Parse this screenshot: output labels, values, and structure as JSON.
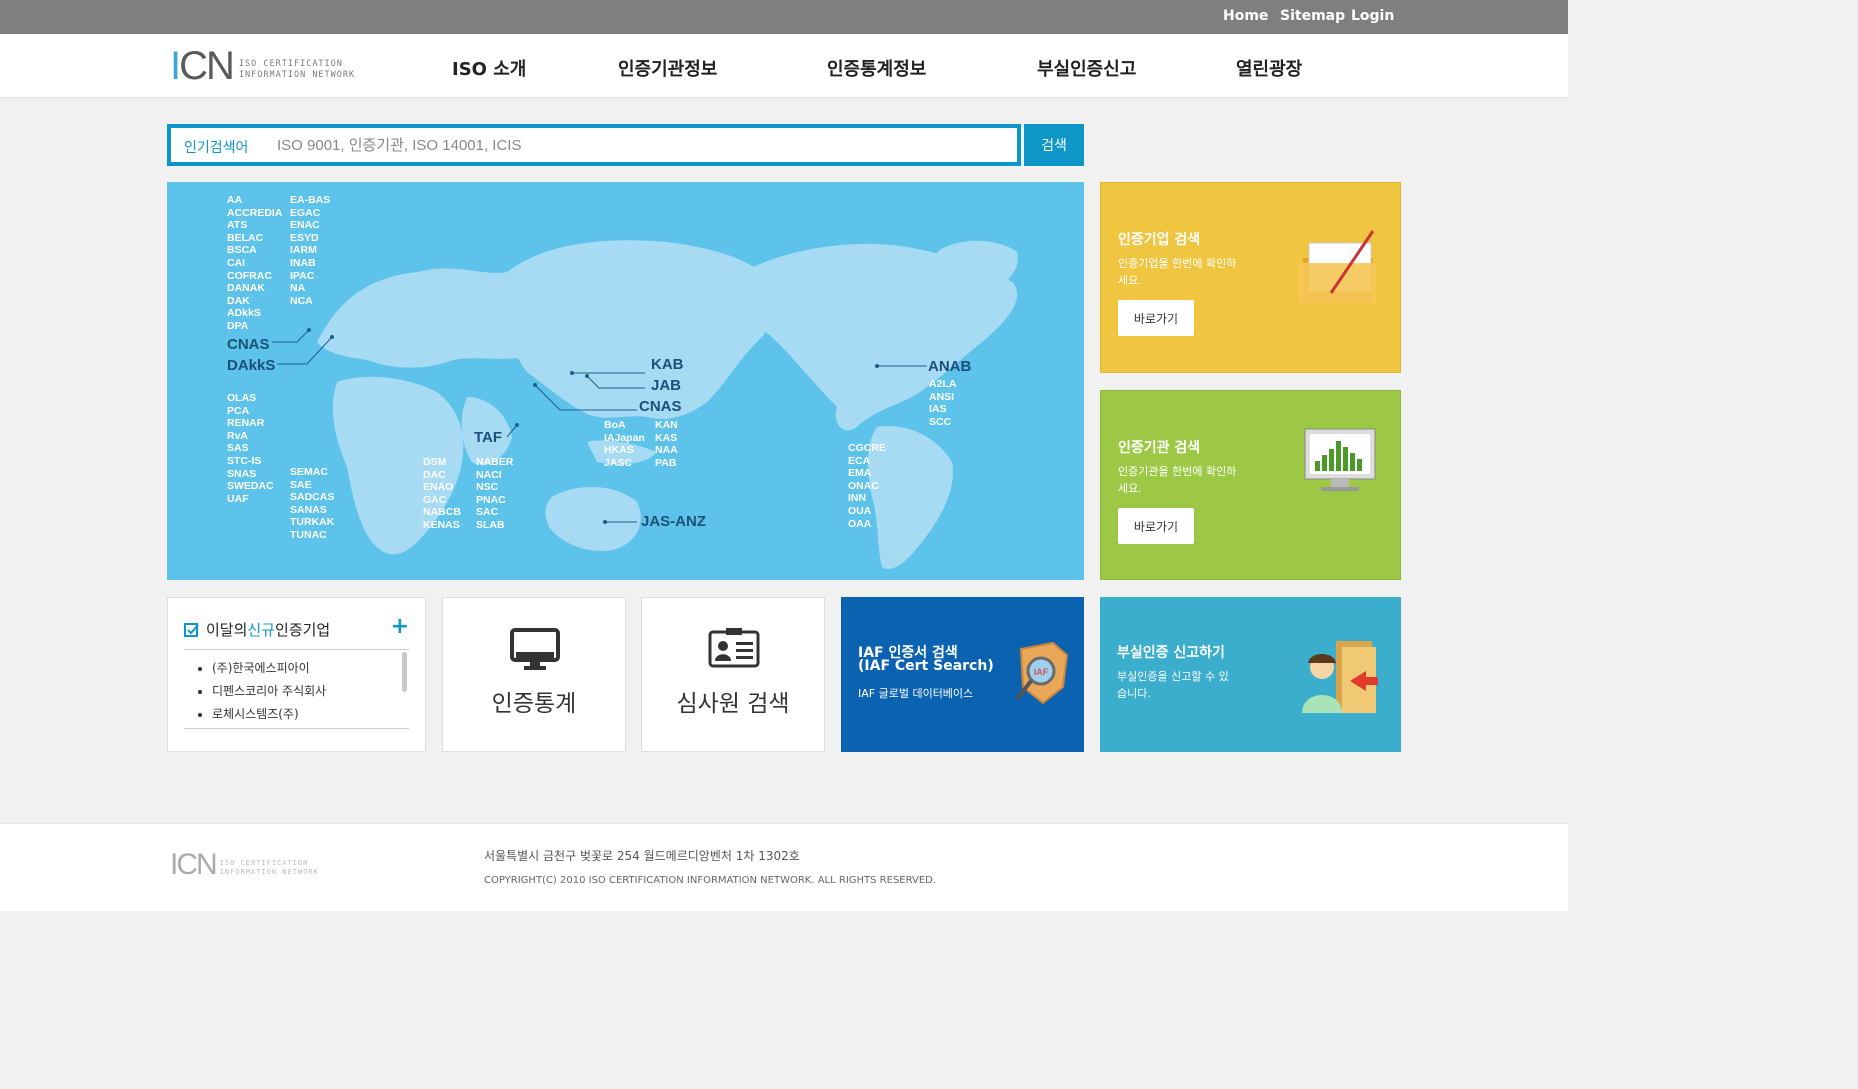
{
  "topbar": {
    "home": "Home",
    "sitemap": "Sitemap",
    "login": "Login"
  },
  "logo": {
    "mark_i": "I",
    "mark_cn": "CN",
    "line1": "ISO CERTIFICATION",
    "line2": "INFORMATION NETWORK"
  },
  "nav": {
    "items": [
      "ISO 소개",
      "인증기관정보",
      "인증통계정보",
      "부실인증신고",
      "열린광장"
    ]
  },
  "search": {
    "label": "인기검색어",
    "placeholder": "ISO 9001, 인증기관, ISO 14001, ICIS",
    "button": "검색"
  },
  "map": {
    "col1": "AA\nACCREDIA\nATS\nBELAC\nBSCA\nCAI\nCOFRAC\nDANAK\nDAK\nADkkS\nDPA",
    "col2": "EA-BAS\nEGAC\nENAC\nESYD\nIARM\nINAB\nIPAC\nNA\nNCA",
    "cnas_eu": "CNAS",
    "dakks": "DAkkS",
    "col3": "OLAS\nPCA\nRENAR\nRvA\nSAS\nSTC-IS\nSNAS\nSWEDAC\nUAF",
    "col4": "SEMAC\nSAE\nSADCAS\nSANAS\nTURKAK\nTUNAC",
    "taf": "TAF",
    "col5": "DSM\nDAC\nENAO\nGAC\nNABCB\nKENAS",
    "col6": "NABER\nNACI\nNSC\nPNAC\nSAC\nSLAB",
    "kab": "KAB",
    "jab": "JAB",
    "cnas_asia": "CNAS",
    "col7": "BoA\nIAJapan\nHKAS\nJASC",
    "col8": "KAN\nKAS\nNAA\nPAB",
    "jasanz": "JAS-ANZ",
    "anab": "ANAB",
    "col9": "A2LA\nANSI\nIAS\nSCC",
    "col10": "CGCRE\nECA\nEMA\nONAC\nINN\nOUA\nOAA"
  },
  "cards": {
    "company": {
      "title": "인증기업 검색",
      "desc": "인증기업을 한번에 확인하세요.",
      "button": "바로가기",
      "color": "#f0c540"
    },
    "agency": {
      "title": "인증기관 검색",
      "desc": "인증기관을 한번에 확인하세요.",
      "button": "바로가기",
      "color": "#9cc845"
    }
  },
  "newcompanies": {
    "title_pre": "이달의 ",
    "title_hl": "신규",
    "title_post": " 인증기업",
    "plus": "+",
    "items": [
      "(주)한국에스피아이",
      "디펜스코리아 주식회사",
      "로체시스템즈(주)"
    ]
  },
  "tiles": {
    "stats": "인증통계",
    "auditor": "심사원 검색"
  },
  "iaf": {
    "title1": "IAF 인증서 검색",
    "title2": "(IAF Cert Search)",
    "desc": "IAF 글로벌 데이터베이스",
    "color": "#0a62b0",
    "badge": "IAF"
  },
  "report": {
    "title": "부실인증 신고하기",
    "desc": "부실인증을 신고할 수 있습니다.",
    "color": "#3aaecc"
  },
  "footer": {
    "mark": "ICN",
    "line1": "ISO CERTIFICATION",
    "line2": "INFORMATION NETWORK",
    "address": "서울특별시 금천구 벚꽃로 254 월드메르디앙벤처 1차 1302호",
    "copyright": "COPYRIGHT(C) 2010 ISO CERTIFICATION INFORMATION NETWORK. ALL RIGHTS RESERVED."
  }
}
